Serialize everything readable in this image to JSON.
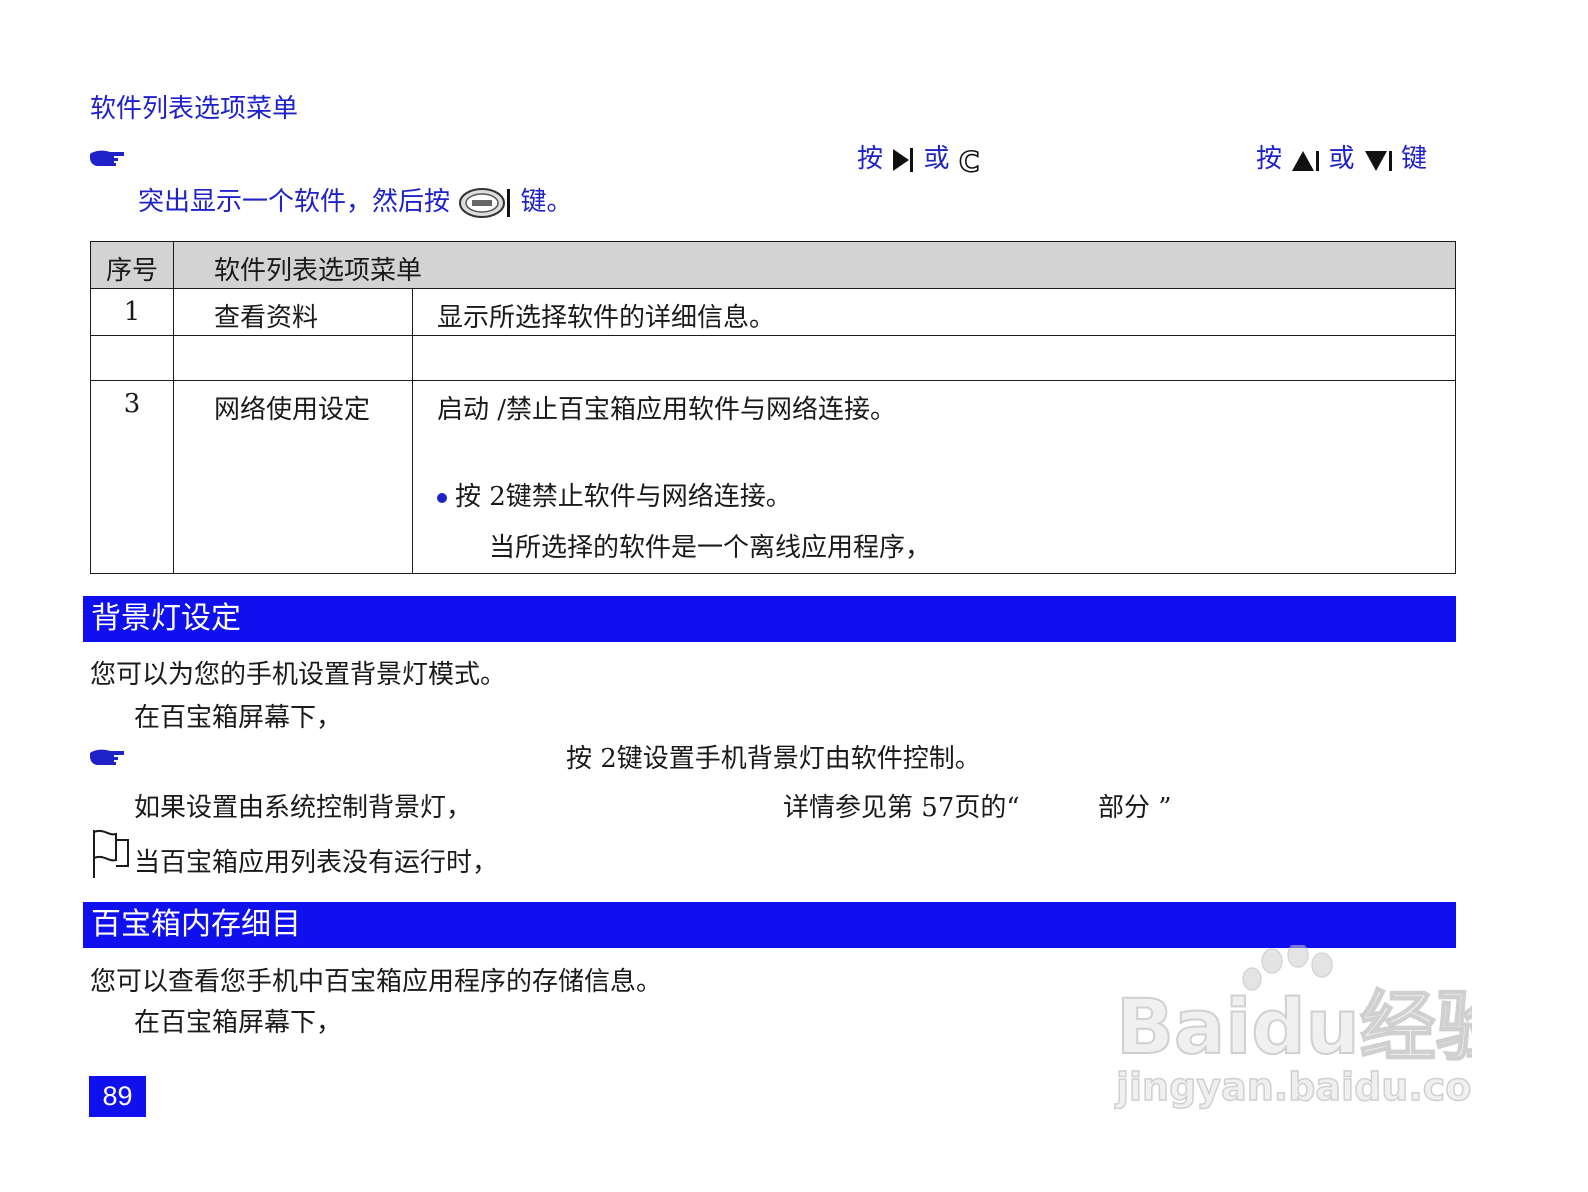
{
  "heading": "软件列表选项菜单",
  "instruction": {
    "line1_a": "按",
    "line1_b": "或",
    "line1_c": "按",
    "line1_d": "或",
    "line1_e": "键",
    "line2": "突出显示一个软件，然后按",
    "line2_end": "键。"
  },
  "table": {
    "header": [
      "序号",
      "软件列表选项菜单"
    ],
    "rows": [
      {
        "no": "1",
        "name": "查看资料",
        "desc": "显示所选择软件的详细信息。"
      },
      {
        "no": "",
        "name": "",
        "desc": ""
      },
      {
        "no": "3",
        "name": "网络使用设定",
        "desc": "启动 /禁止百宝箱应用软件与网络连接。",
        "bullet": "按 2键禁止软件与网络连接。",
        "note": "当所选择的软件是一个离线应用程序，"
      }
    ]
  },
  "section1": {
    "title": "背景灯设定",
    "line1": "您可以为您的手机设置背景灯模式。",
    "line2": "在百宝箱屏幕下，",
    "line3": "按 2键设置手机背景灯由软件控制。",
    "line4a": "如果设置由系统控制背景灯，",
    "line4b": "详情参见第 57页的“",
    "line4c": "部分 ”",
    "note": "当百宝箱应用列表没有运行时，"
  },
  "section2": {
    "title": "百宝箱内存细目",
    "line1": "您可以查看您手机中百宝箱应用程序的存储信息。",
    "line2": "在百宝箱屏幕下，"
  },
  "page_number": "89",
  "watermark": {
    "brand": "Baidu经验",
    "url": "jingyan.baidu.com"
  },
  "colors": {
    "accent_blue": "#1010ee",
    "text_blue": "#1f22c8",
    "header_gray": "#d3d3d3"
  }
}
